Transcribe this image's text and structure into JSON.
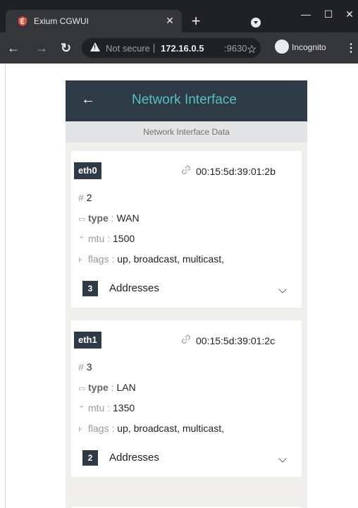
{
  "browser": {
    "tab_title": "Exium CGWUI",
    "not_secure": "Not secure",
    "url_host": "172.16.0.5",
    "url_port": ":9630",
    "incognito_label": "Incognito",
    "accent": "#e8eaed"
  },
  "app": {
    "title": "Network Interface",
    "subtitle": "Network Interface Data",
    "header_color": "#2e3a45",
    "title_color": "#53c2c2"
  },
  "interfaces": [
    {
      "name": "eth0",
      "mac": "00:15:5d:39:01:2b",
      "index_symbol": "#",
      "index": "2",
      "type_label": "type",
      "type_sep": " : ",
      "type": "WAN",
      "mtu_label": "mtu",
      "mtu_sep": " : ",
      "mtu": "1500",
      "flags_label": "flags",
      "flags_sep": " : ",
      "flags": "up, broadcast, multicast,",
      "address_count": "3",
      "addresses_label": "Addresses"
    },
    {
      "name": "eth1",
      "mac": "00:15:5d:39:01:2c",
      "index_symbol": "#",
      "index": "3",
      "type_label": "type",
      "type_sep": " : ",
      "type": "LAN",
      "mtu_label": "mtu",
      "mtu_sep": " : ",
      "mtu": "1350",
      "flags_label": "flags",
      "flags_sep": " : ",
      "flags": "up, broadcast, multicast,",
      "address_count": "2",
      "addresses_label": "Addresses"
    }
  ]
}
